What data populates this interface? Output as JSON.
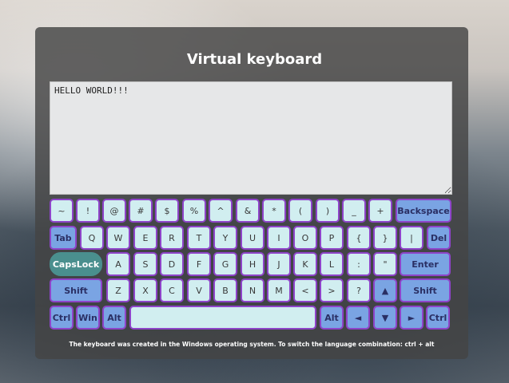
{
  "app": {
    "title": "Virtual keyboard",
    "footnote": "The keyboard was created in the Windows operating system. To switch the language combination: ctrl + alt"
  },
  "editor": {
    "value": "HELLO WORLD!!!"
  },
  "keyboard": {
    "row1": [
      "~",
      "!",
      "@",
      "#",
      "$",
      "%",
      "^",
      "&",
      "*",
      "(",
      ")",
      "_",
      "+",
      "Backspace"
    ],
    "row2": [
      "Tab",
      "Q",
      "W",
      "E",
      "R",
      "T",
      "Y",
      "U",
      "I",
      "O",
      "P",
      "{",
      "}",
      "|",
      "Del"
    ],
    "row3": [
      "CapsLock",
      "A",
      "S",
      "D",
      "F",
      "G",
      "H",
      "J",
      "K",
      "L",
      ":",
      "\"",
      "Enter"
    ],
    "row4": [
      "Shift",
      "Z",
      "X",
      "C",
      "V",
      "B",
      "N",
      "M",
      "<",
      ">",
      "?",
      "▲",
      "Shift"
    ],
    "row5": [
      "Ctrl",
      "Win",
      "Alt",
      "",
      "Alt",
      "◄",
      "▼",
      "►",
      "Ctrl"
    ]
  },
  "colors": {
    "key_bg": "#d1eef0",
    "function_key_bg": "#7aa4e3",
    "capslock_bg": "#4a8f8e",
    "key_border": "#8e44c9",
    "panel_bg": "#444444"
  }
}
